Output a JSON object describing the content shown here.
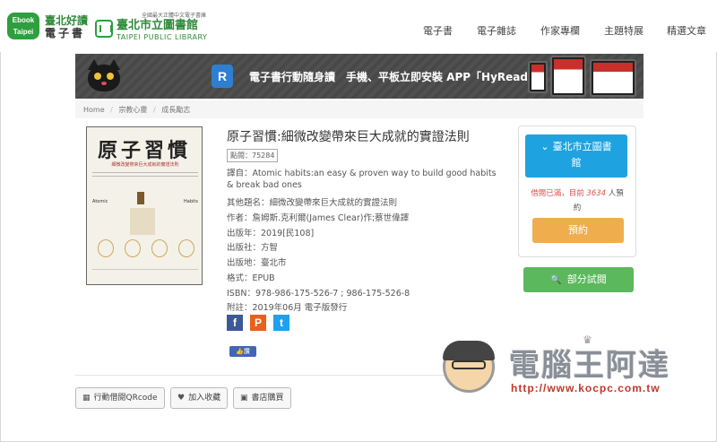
{
  "header": {
    "ebook_logo": [
      "Ebook",
      "Taipei"
    ],
    "ebook_title_line1": "臺北好讀",
    "ebook_title_line2": "電子書",
    "tpl_tagline": "全國最大正體中文電子書庫",
    "tpl_name": "臺北市立圖書館",
    "tpl_name_en": "TAIPEI PUBLIC LIBRARY",
    "nav": [
      "電子書",
      "電子雜誌",
      "作家專欄",
      "主題特展",
      "精選文章"
    ]
  },
  "banner": {
    "logo_letter": "R",
    "text": "電子書行動隨身讀　手機、平板立即安裝 APP「HyRead」"
  },
  "breadcrumb": [
    "Home",
    "宗教心靈",
    "成長勵志"
  ],
  "cover": {
    "title": "原子習慣",
    "subtitle": "細微改變帶來巨大成就的實證法則",
    "side_left": "Atomic",
    "side_right": "Habits"
  },
  "book": {
    "title": "原子習慣:細微改變帶來巨大成就的實證法則",
    "clicks": "點閱：75284",
    "translated_from_1": "譯自：Atomic habits:an easy & proven way to build good habits",
    "translated_from_2": "& break bad ones",
    "other_title": "其他題名：細微改變帶來巨大成就的實證法則",
    "author": "作者：詹姆斯.克利爾(James Clear)作;蔡世偉譯",
    "year": "出版年：2019[民108]",
    "publisher": "出版社：方智",
    "place": "出版地：臺北市",
    "format": "格式：EPUB",
    "isbn": "ISBN：978-986-175-526-7 ; 986-175-526-8",
    "note": "附註：2019年06月 電子版發行"
  },
  "share": {
    "facebook": "f",
    "plurk": "P",
    "twitter": "t",
    "like": "讚"
  },
  "panel": {
    "library_button_line1": "臺北市立圖書",
    "library_button_line2": "館",
    "status_prefix": "借閱已滿，目前",
    "status_count": "3634",
    "status_suffix": "人預",
    "status_line2": "約",
    "reserve": "預約",
    "trial": "部分試閱"
  },
  "actions": {
    "qrcode": "行動借閱QRcode",
    "favorite": "加入收藏",
    "store": "書店購買"
  },
  "watermark": {
    "title": "電腦王阿達",
    "url": "http://www.kocpc.com.tw"
  },
  "colors": {
    "brand_green": "#2f9e3f",
    "library_blue": "#1ea3e0",
    "reserve_orange": "#f0ad4e",
    "trial_green": "#5cb85c",
    "status_red": "#d9534f"
  }
}
